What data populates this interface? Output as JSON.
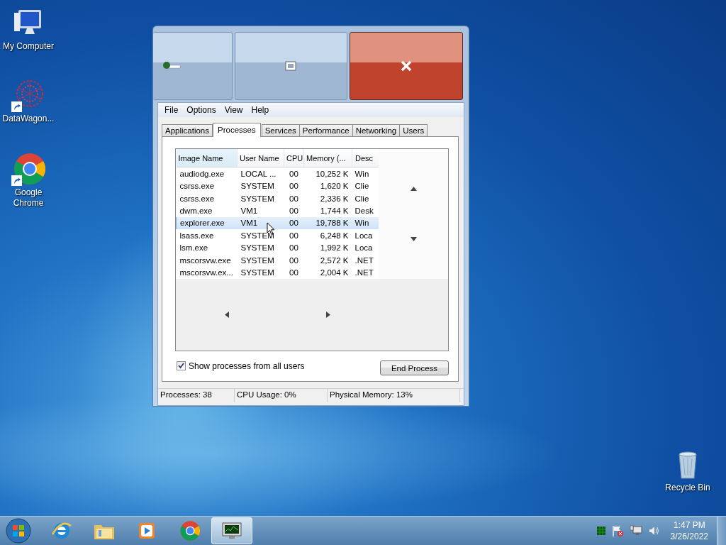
{
  "desktop_icons": [
    {
      "label": "My Computer",
      "shortcut": false
    },
    {
      "label": "DataWagon...",
      "shortcut": true
    },
    {
      "label": "Google Chrome",
      "shortcut": true
    },
    {
      "label": "Recycle Bin",
      "shortcut": false
    }
  ],
  "window": {
    "menu": [
      "File",
      "Options",
      "View",
      "Help"
    ],
    "tabs": [
      {
        "label": "Applications",
        "selected": false
      },
      {
        "label": "Processes",
        "selected": true
      },
      {
        "label": "Services",
        "selected": false
      },
      {
        "label": "Performance",
        "selected": false
      },
      {
        "label": "Networking",
        "selected": false
      },
      {
        "label": "Users",
        "selected": false
      }
    ],
    "columns": [
      "Image Name",
      "User Name",
      "CPU",
      "Memory (...",
      "Desc"
    ],
    "rows": [
      {
        "cells": [
          "audiodg.exe",
          "LOCAL ...",
          "00",
          "10,252 K",
          "Win"
        ],
        "selected": false
      },
      {
        "cells": [
          "csrss.exe",
          "SYSTEM",
          "00",
          "1,620 K",
          "Clie"
        ],
        "selected": false
      },
      {
        "cells": [
          "csrss.exe",
          "SYSTEM",
          "00",
          "2,336 K",
          "Clie"
        ],
        "selected": false
      },
      {
        "cells": [
          "dwm.exe",
          "VM1",
          "00",
          "1,744 K",
          "Desk"
        ],
        "selected": false
      },
      {
        "cells": [
          "explorer.exe",
          "VM1",
          "00",
          "19,788 K",
          "Win"
        ],
        "selected": true
      },
      {
        "cells": [
          "lsass.exe",
          "SYSTEM",
          "00",
          "6,248 K",
          "Loca"
        ],
        "selected": false
      },
      {
        "cells": [
          "lsm.exe",
          "SYSTEM",
          "00",
          "1,992 K",
          "Loca"
        ],
        "selected": false
      },
      {
        "cells": [
          "mscorsvw.exe",
          "SYSTEM",
          "00",
          "2,572 K",
          ".NET"
        ],
        "selected": false
      },
      {
        "cells": [
          "mscorsvw.ex...",
          "SYSTEM",
          "00",
          "2,004 K",
          ".NET"
        ],
        "selected": false
      }
    ],
    "show_all_users": {
      "label": "Show processes from all users",
      "checked": true
    },
    "end_button": "End Process",
    "status_bar": [
      "Processes: 38",
      "CPU Usage: 0%",
      "Physical Memory: 13%"
    ]
  },
  "taskbar": {
    "apps": [
      {
        "selected": false
      },
      {
        "selected": false
      },
      {
        "selected": false
      },
      {
        "selected": false
      },
      {
        "selected": true
      }
    ],
    "time": "1:47 PM",
    "date": "3/26/2022"
  }
}
